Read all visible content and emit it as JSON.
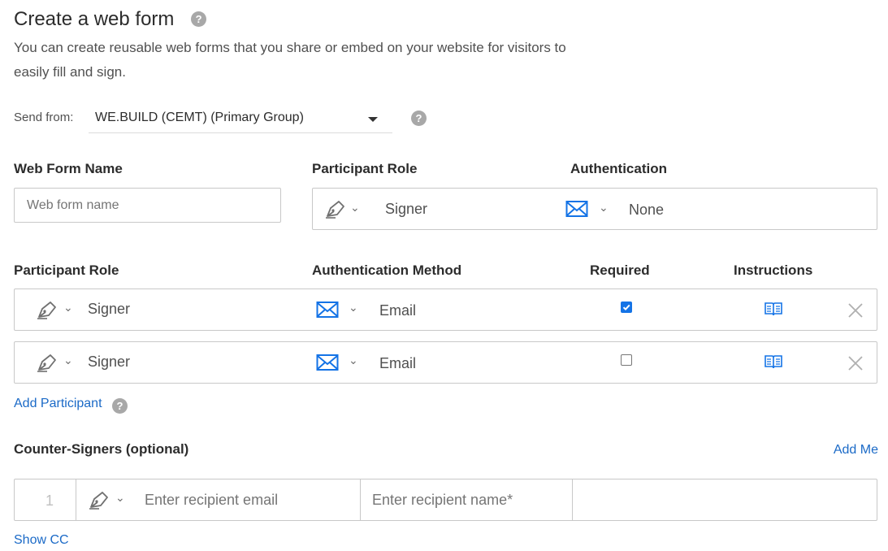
{
  "page": {
    "title": "Create a web form",
    "subtitle": "You can create reusable web forms that you share or embed on your website for visitors to easily fill and sign."
  },
  "send_from": {
    "label": "Send from:",
    "value": "WE.BUILD (CEMT) (Primary Group)"
  },
  "web_form_name": {
    "header": "Web Form Name",
    "placeholder": "Web form name"
  },
  "top_participant": {
    "role_header": "Participant Role",
    "auth_header": "Authentication",
    "role": "Signer",
    "auth": "None"
  },
  "participants_table": {
    "headers": {
      "role": "Participant Role",
      "auth_method": "Authentication Method",
      "required": "Required",
      "instructions": "Instructions"
    },
    "rows": [
      {
        "role": "Signer",
        "auth": "Email",
        "required": true
      },
      {
        "role": "Signer",
        "auth": "Email",
        "required": false
      }
    ]
  },
  "add_participant": "Add Participant",
  "counter_signers": {
    "header": "Counter-Signers (optional)",
    "add_me": "Add Me",
    "row": {
      "index": "1",
      "email_placeholder": "Enter recipient email",
      "name_placeholder": "Enter recipient name*"
    }
  },
  "show_cc": "Show CC",
  "help_glyph": "?",
  "colors": {
    "link": "#1b6ac7",
    "icon_blue": "#1473e6",
    "help_gray": "#a8a8a8"
  }
}
